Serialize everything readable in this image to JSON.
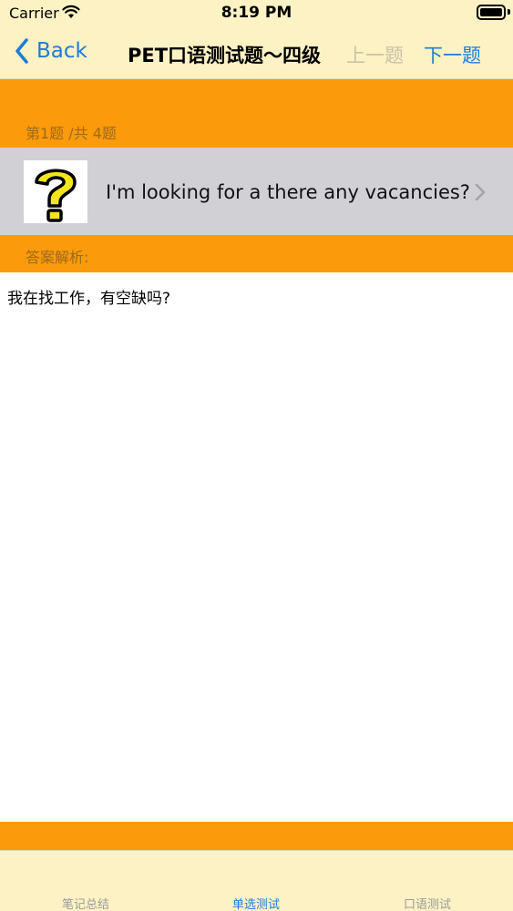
{
  "status_bar": {
    "carrier": "Carrier",
    "time": "8:19 PM"
  },
  "navbar": {
    "back_label": "Back",
    "title": "PET口语测试题～四级",
    "prev_label": "上一题",
    "next_label": "下一题"
  },
  "question": {
    "counter": "第1题 /共 4题",
    "text": "I'm looking for a  there any vacancies?",
    "image_icon": "question-mark-icon"
  },
  "answer": {
    "label": "答案解析:",
    "text": "我在找工作，有空缺吗?"
  },
  "tabbar": {
    "tabs": [
      {
        "label": "笔记总结"
      },
      {
        "label": "单选测试"
      },
      {
        "label": "口语测试"
      }
    ],
    "active_index": 1
  },
  "colors": {
    "accent": "#1f7bd8",
    "orange": "#fb9a0a",
    "bar_background": "#fdf2c4",
    "row_gray": "#d1d0d5"
  }
}
